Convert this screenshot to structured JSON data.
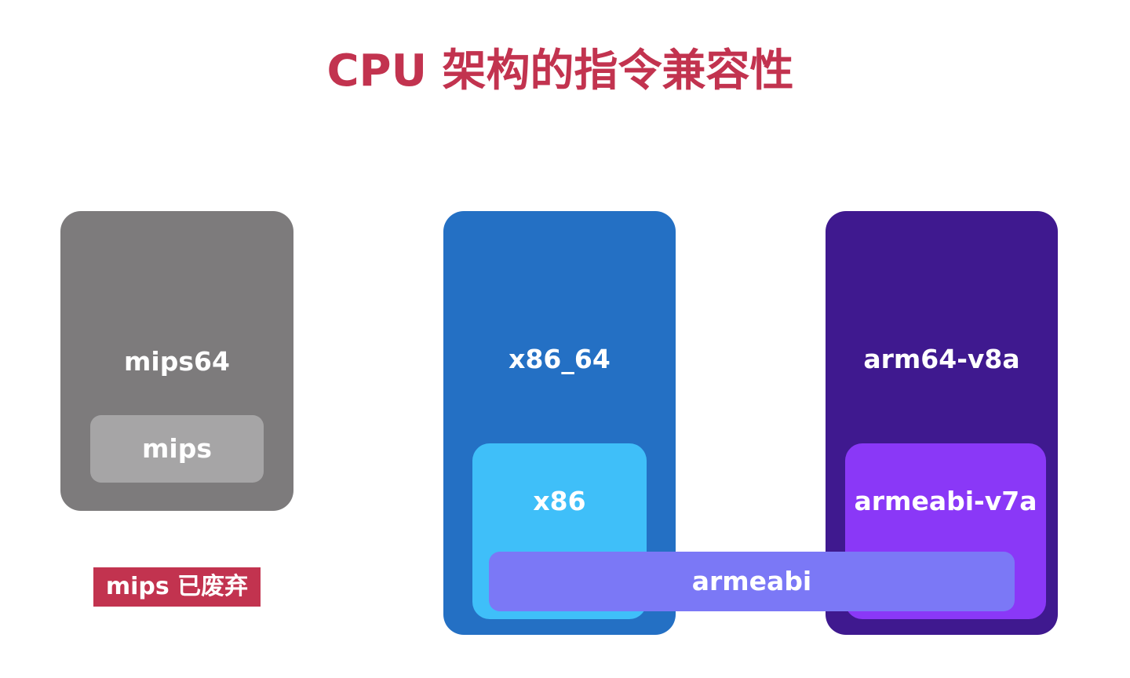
{
  "title": "CPU 架构的指令兼容性",
  "colors": {
    "title": "#c2334f",
    "mips_outer": "#7d7b7c",
    "mips_inner": "#a6a5a6",
    "x86_outer": "#2470c4",
    "x86_inner": "#3fbff9",
    "arm_outer": "#3f198f",
    "arm_inner": "#8a38f7",
    "armeabi_bar": "#7b78f6",
    "badge": "#c2334f"
  },
  "groups": {
    "mips": {
      "outer_label": "mips64",
      "inner_label": "mips",
      "deprecated_badge": "mips 已废弃"
    },
    "x86": {
      "outer_label": "x86_64",
      "inner_label": "x86"
    },
    "arm": {
      "outer_label": "arm64-v8a",
      "inner_label": "armeabi-v7a"
    }
  },
  "armeabi": {
    "label": "armeabi"
  }
}
